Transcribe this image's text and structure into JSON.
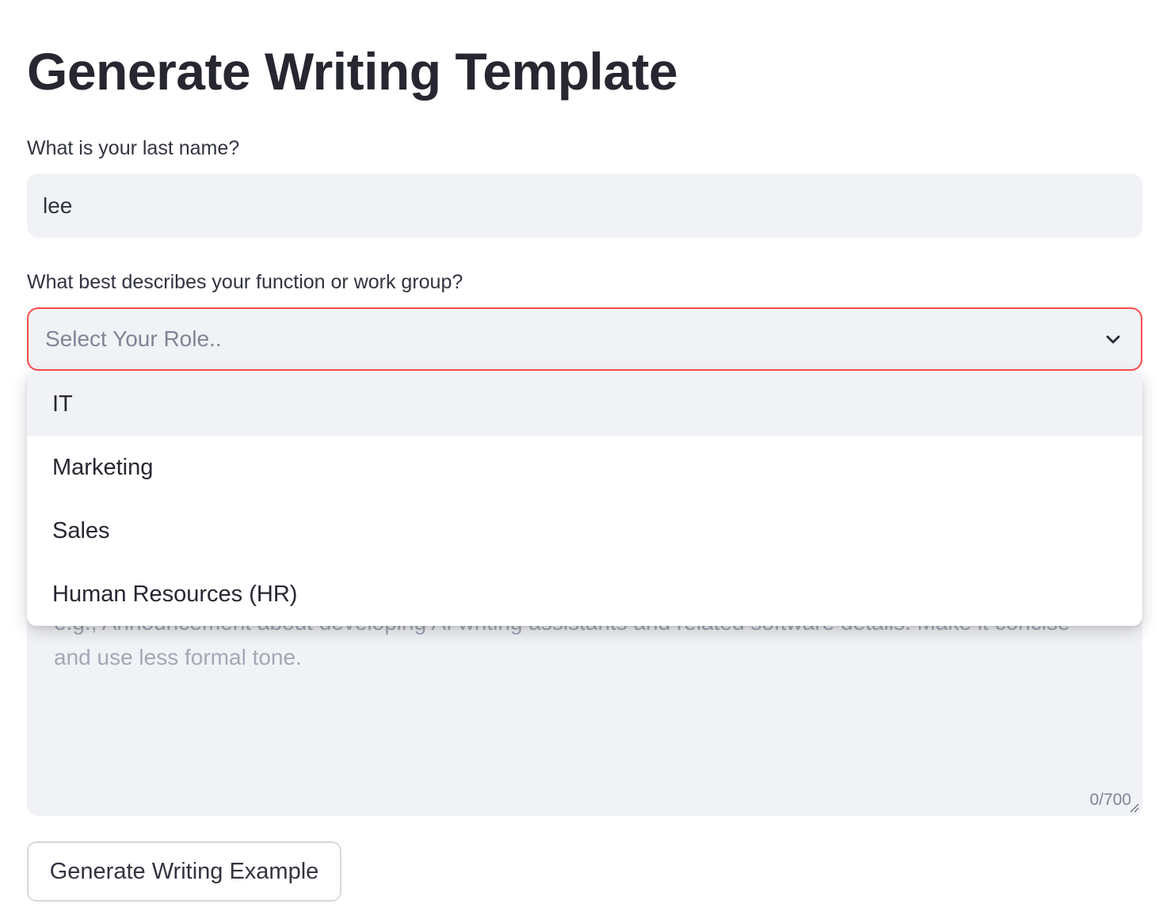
{
  "page": {
    "title": "Generate Writing Template"
  },
  "last_name": {
    "label": "What is your last name?",
    "value": "lee"
  },
  "role_select": {
    "label": "What best describes your function or work group?",
    "placeholder": "Select Your Role..",
    "options": [
      "IT",
      "Marketing",
      "Sales",
      "Human Resources (HR)"
    ],
    "highlighted_index": 0,
    "chevron_icon": "chevron-down-icon",
    "focus_border_color": "#ff4b4b"
  },
  "description": {
    "placeholder_partial": "e.g., Announcement about developing AI writing assistants and related software details. Make it concise and use less formal tone.",
    "placeholder_visible_line": "concise and use less formal tone.",
    "counter": "0/700"
  },
  "actions": {
    "generate_label": "Generate Writing Example"
  },
  "colors": {
    "input_background": "#f0f2f6",
    "accent": "#ff4b4b",
    "text": "#31333f",
    "placeholder": "#808495"
  }
}
